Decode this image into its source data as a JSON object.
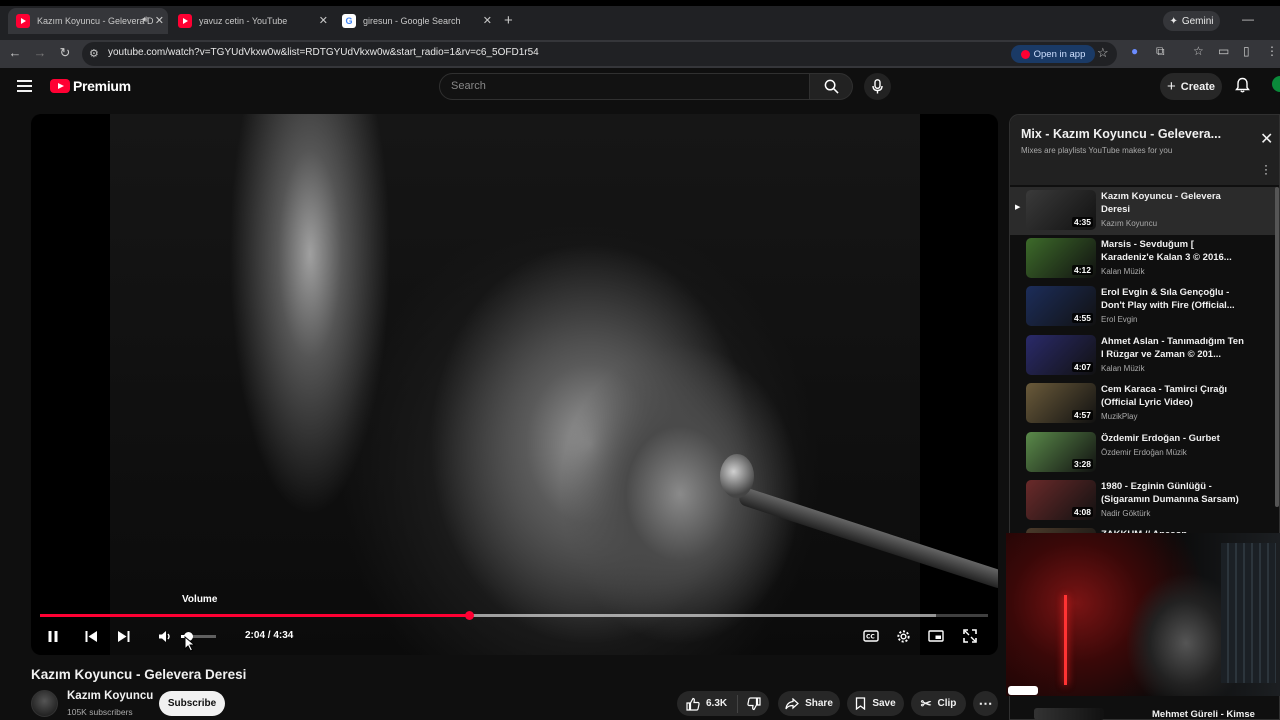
{
  "browser": {
    "tabs": [
      {
        "title": "Kazım Koyuncu - Gelevera D",
        "favicon": "youtube-icon",
        "active": true
      },
      {
        "title": "yavuz cetin - YouTube",
        "favicon": "youtube-icon",
        "active": false
      },
      {
        "title": "giresun - Google Search",
        "favicon": "google-icon",
        "active": false
      }
    ],
    "gemini_label": "Gemini",
    "url": "youtube.com/watch?v=TGYUdVkxw0w&list=RDTGYUdVkxw0w&start_radio=1&rv=c6_5OFD1r54",
    "open_in_app_label": "Open in app"
  },
  "header": {
    "logo_text": "Premium",
    "search_placeholder": "Search",
    "create_label": "Create"
  },
  "player": {
    "tooltip": "Volume",
    "time": "2:04 / 4:34",
    "progress_fraction": 0.453,
    "buffered_fraction": 0.945,
    "volume_fraction": 0.2
  },
  "video": {
    "title": "Kazım Koyuncu - Gelevera Deresi",
    "channel": "Kazım Koyuncu",
    "subscribers": "105K subscribers",
    "subscribe_label": "Subscribe",
    "likes": "6.3K",
    "share_label": "Share",
    "save_label": "Save",
    "clip_label": "Clip"
  },
  "playlist": {
    "title": "Mix - Kazım Koyuncu - Gelevera...",
    "subtitle": "Mixes are playlists YouTube makes for you",
    "items": [
      {
        "title": "Kazım Koyuncu - Gelevera Deresi",
        "channel": "Kazım Koyuncu",
        "duration": "4:35",
        "active": true,
        "thumb": "#3a3a3a"
      },
      {
        "title": "Marsis - Sevduğum [ Karadeniz'e Kalan 3 © 2016...",
        "channel": "Kalan Müzik",
        "duration": "4:12",
        "active": false,
        "thumb": "#3d6b2a"
      },
      {
        "title": "Erol Evgin & Sıla Gençoğlu - Don't Play with Fire (Official...",
        "channel": "Erol Evgin",
        "duration": "4:55",
        "active": false,
        "thumb": "#1c2d5a"
      },
      {
        "title": "Ahmet Aslan - Tanımadığım Ten I Rüzgar ve Zaman © 201...",
        "channel": "Kalan Müzik",
        "duration": "4:07",
        "active": false,
        "thumb": "#2a2a6a"
      },
      {
        "title": "Cem Karaca - Tamirci Çırağı (Official Lyric Video)",
        "channel": "MuzikPlay",
        "duration": "4:57",
        "active": false,
        "thumb": "#6a5a3a"
      },
      {
        "title": "Özdemir Erdoğan - Gurbet",
        "channel": "Özdemir Erdoğan Müzik",
        "duration": "3:28",
        "active": false,
        "thumb": "#5a8a4a"
      },
      {
        "title": "1980 - Ezginin Günlüğü - (Sigaramın Dumanına Sarsam)",
        "channel": "Nadir Göktürk",
        "duration": "4:08",
        "active": false,
        "thumb": "#6a2a2a"
      },
      {
        "title": "ZAKKUM // Anason",
        "channel": "",
        "duration": "",
        "active": false,
        "thumb": "#4a3a2a"
      }
    ]
  },
  "below": {
    "next_title": "Mehmet Güreli - Kimse"
  }
}
